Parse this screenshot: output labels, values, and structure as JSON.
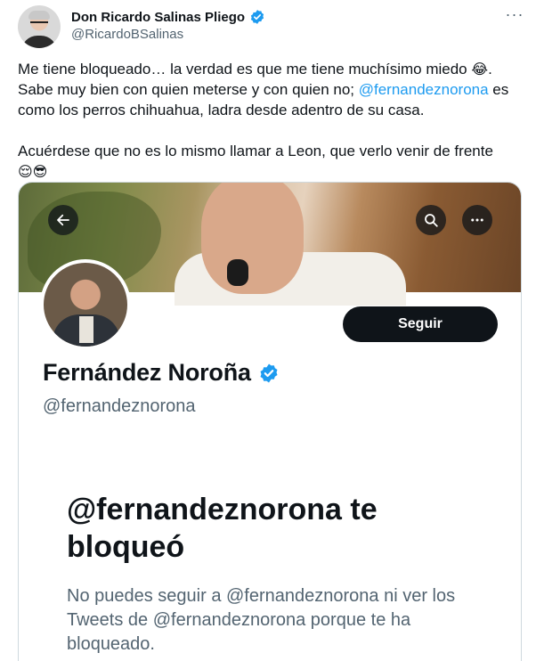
{
  "tweet": {
    "author_name": "Don Ricardo Salinas Pliego",
    "author_handle": "@RicardoBSalinas",
    "more_label": "···",
    "line1": "Me tiene bloqueado… la verdad es que me tiene muchísimo miedo ",
    "line1_emoji": "😂",
    "line1_end": ".",
    "line2_start": "Sabe muy bien con quien meterse y con quien no; ",
    "mention": "@fernandeznorona",
    "line2_end": " es como los perros chihuahua, ladra desde adentro de su casa.",
    "line3": "Acuérdese que no es lo mismo llamar a Leon, que verlo venir de frente",
    "line3_emojis": "😌😎"
  },
  "screenshot": {
    "profile_name": "Fernández Noroña",
    "profile_handle": "@fernandeznorona",
    "follow_label": "Seguir",
    "blocked_title": "@fernandeznorona te bloqueó",
    "blocked_desc": "No puedes seguir a @fernandeznorona ni ver los Tweets de @fernandeznorona porque te ha bloqueado."
  },
  "colors": {
    "accent": "#1d9bf0",
    "text_primary": "#0f1419",
    "text_secondary": "#536471",
    "button_bg": "#0f1419",
    "border": "#cfd9de"
  },
  "icons": {
    "verified": "verified-badge-icon",
    "back": "arrow-left-icon",
    "search": "search-icon",
    "more": "more-horizontal-icon"
  }
}
